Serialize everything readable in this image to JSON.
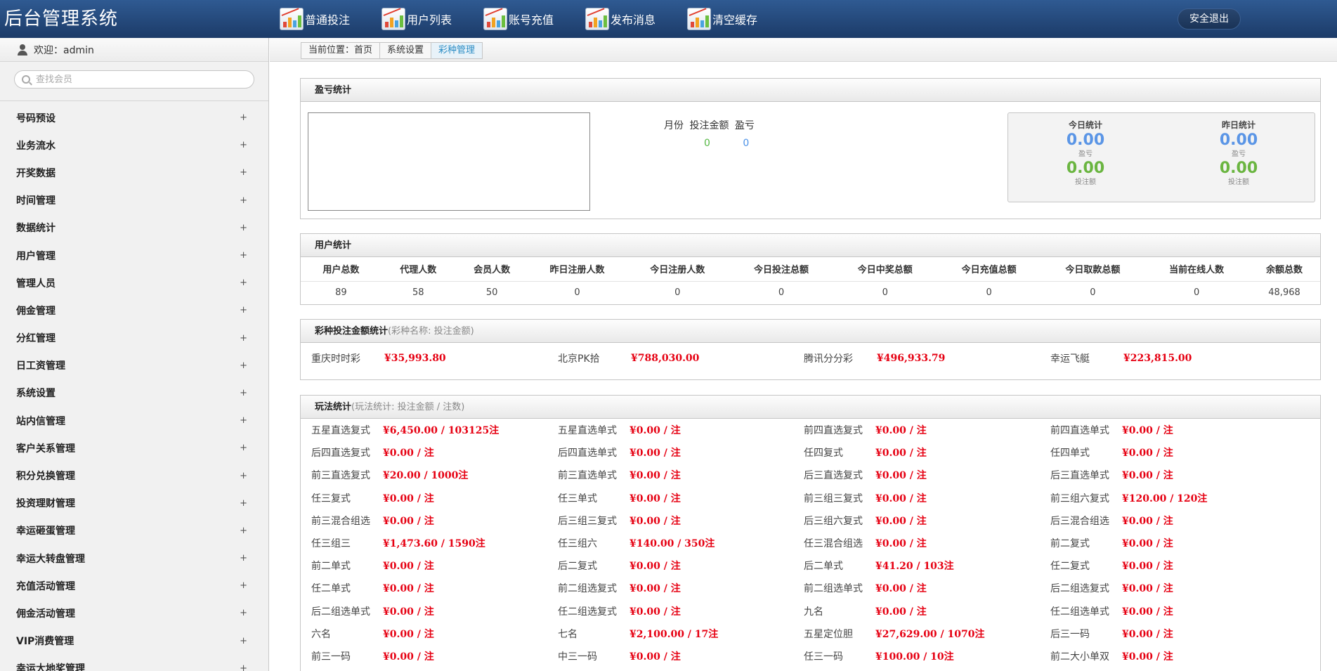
{
  "app": {
    "title": "后台管理系统",
    "logout_label": "安全退出"
  },
  "topnav": [
    {
      "label": "普通投注"
    },
    {
      "label": "用户列表"
    },
    {
      "label": "账号充值"
    },
    {
      "label": "发布消息"
    },
    {
      "label": "清空缓存"
    }
  ],
  "sidebar": {
    "welcome": "欢迎：admin",
    "search_placeholder": "查找会员",
    "expand_symbol": "+",
    "items": [
      "号码预设",
      "业务流水",
      "开奖数据",
      "时间管理",
      "数据统计",
      "用户管理",
      "管理人员",
      "佣金管理",
      "分红管理",
      "日工资管理",
      "系统设置",
      "站内信管理",
      "客户关系管理",
      "积分兑换管理",
      "投资理财管理",
      "幸运砸蛋管理",
      "幸运大转盘管理",
      "充值活动管理",
      "佣金活动管理",
      "VIP消费管理",
      "幸运大地奖管理"
    ]
  },
  "breadcrumb": {
    "prefix": "当前位置：首页",
    "level2": "系统设置",
    "current": "彩种管理"
  },
  "profit": {
    "title": "盈亏统计",
    "month_headers": [
      "月份",
      "投注金额",
      "盈亏"
    ],
    "month_values": [
      "0",
      "0"
    ],
    "today": {
      "title": "今日统计",
      "profit": "0.00",
      "profit_label": "盈亏",
      "bet": "0.00",
      "bet_label": "投注额"
    },
    "yesterday": {
      "title": "昨日统计",
      "profit": "0.00",
      "profit_label": "盈亏",
      "bet": "0.00",
      "bet_label": "投注额"
    },
    "colors": {
      "blue": "#5a95e6",
      "green": "#6ab540"
    }
  },
  "users": {
    "title": "用户统计",
    "headers": [
      "用户总数",
      "代理人数",
      "会员人数",
      "昨日注册人数",
      "今日注册人数",
      "今日投注总额",
      "今日中奖总额",
      "今日充值总额",
      "今日取款总额",
      "当前在线人数",
      "余额总数"
    ],
    "values": [
      "89",
      "58",
      "50",
      "0",
      "0",
      "0",
      "0",
      "0",
      "0",
      "0",
      "48,968"
    ]
  },
  "lottery": {
    "title": "彩种投注金额统计",
    "subtitle": "(彩种名称: 投注金额)",
    "items": [
      {
        "name": "重庆时时彩",
        "value": "¥35,993.80"
      },
      {
        "name": "北京PK拾",
        "value": "¥788,030.00"
      },
      {
        "name": "腾讯分分彩",
        "value": "¥496,933.79"
      },
      {
        "name": "幸运飞艇",
        "value": "¥223,815.00"
      }
    ]
  },
  "plays": {
    "title": "玩法统计",
    "subtitle": "(玩法统计: 投注金额 / 注数)",
    "rows": [
      [
        {
          "name": "五星直选复式",
          "value": "¥6,450.00 / 103125注"
        },
        {
          "name": "五星直选单式",
          "value": "¥0.00 / 注"
        },
        {
          "name": "前四直选复式",
          "value": "¥0.00 / 注"
        },
        {
          "name": "前四直选单式",
          "value": "¥0.00 / 注"
        }
      ],
      [
        {
          "name": "后四直选复式",
          "value": "¥0.00 / 注"
        },
        {
          "name": "后四直选单式",
          "value": "¥0.00 / 注"
        },
        {
          "name": "任四复式",
          "value": "¥0.00 / 注"
        },
        {
          "name": "任四单式",
          "value": "¥0.00 / 注"
        }
      ],
      [
        {
          "name": "前三直选复式",
          "value": "¥20.00 / 1000注"
        },
        {
          "name": "前三直选单式",
          "value": "¥0.00 / 注"
        },
        {
          "name": "后三直选复式",
          "value": "¥0.00 / 注"
        },
        {
          "name": "后三直选单式",
          "value": "¥0.00 / 注"
        }
      ],
      [
        {
          "name": "任三复式",
          "value": "¥0.00 / 注"
        },
        {
          "name": "任三单式",
          "value": "¥0.00 / 注"
        },
        {
          "name": "前三组三复式",
          "value": "¥0.00 / 注"
        },
        {
          "name": "前三组六复式",
          "value": "¥120.00 / 120注"
        }
      ],
      [
        {
          "name": "前三混合组选",
          "value": "¥0.00 / 注"
        },
        {
          "name": "后三组三复式",
          "value": "¥0.00 / 注"
        },
        {
          "name": "后三组六复式",
          "value": "¥0.00 / 注"
        },
        {
          "name": "后三混合组选",
          "value": "¥0.00 / 注"
        }
      ],
      [
        {
          "name": "任三组三",
          "value": "¥1,473.60 / 1590注"
        },
        {
          "name": "任三组六",
          "value": "¥140.00 / 350注"
        },
        {
          "name": "任三混合组选",
          "value": "¥0.00 / 注"
        },
        {
          "name": "前二复式",
          "value": "¥0.00 / 注"
        }
      ],
      [
        {
          "name": "前二单式",
          "value": "¥0.00 / 注"
        },
        {
          "name": "后二复式",
          "value": "¥0.00 / 注"
        },
        {
          "name": "后二单式",
          "value": "¥41.20 / 103注"
        },
        {
          "name": "任二复式",
          "value": "¥0.00 / 注"
        }
      ],
      [
        {
          "name": "任二单式",
          "value": "¥0.00 / 注"
        },
        {
          "name": "前二组选复式",
          "value": "¥0.00 / 注"
        },
        {
          "name": "前二组选单式",
          "value": "¥0.00 / 注"
        },
        {
          "name": "后二组选复式",
          "value": "¥0.00 / 注"
        }
      ],
      [
        {
          "name": "后二组选单式",
          "value": "¥0.00 / 注"
        },
        {
          "name": "任二组选复式",
          "value": "¥0.00 / 注"
        },
        {
          "name": "九名",
          "value": "¥0.00 / 注"
        },
        {
          "name": "任二组选单式",
          "value": "¥0.00 / 注"
        }
      ],
      [
        {
          "name": "六名",
          "value": "¥0.00 / 注"
        },
        {
          "name": "七名",
          "value": "¥2,100.00 / 17注"
        },
        {
          "name": "五星定位胆",
          "value": "¥27,629.00 / 1070注"
        },
        {
          "name": "后三一码",
          "value": "¥0.00 / 注"
        }
      ],
      [
        {
          "name": "前三一码",
          "value": "¥0.00 / 注"
        },
        {
          "name": "中三一码",
          "value": "¥0.00 / 注"
        },
        {
          "name": "任三一码",
          "value": "¥100.00 / 10注"
        },
        {
          "name": "前二大小单双",
          "value": "¥0.00 / 注"
        }
      ]
    ]
  }
}
